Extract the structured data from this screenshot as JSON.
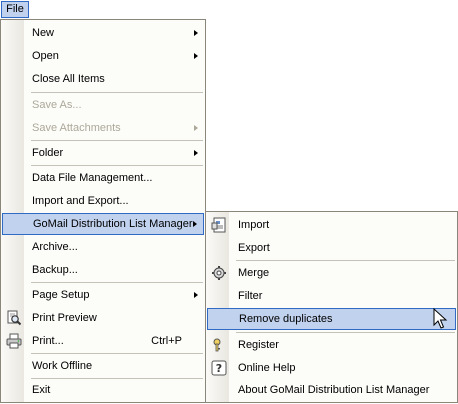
{
  "menubar": {
    "file": "File"
  },
  "file_menu": {
    "new": "New",
    "open": "Open",
    "close_all": "Close All Items",
    "save_as": "Save As...",
    "save_attachments": "Save Attachments",
    "folder": "Folder",
    "data_file_mgmt": "Data File Management...",
    "import_export": "Import and Export...",
    "gomail": "GoMail Distribution List Manager",
    "archive": "Archive...",
    "backup": "Backup...",
    "page_setup": "Page Setup",
    "print_preview": "Print Preview",
    "print": "Print...",
    "print_shortcut": "Ctrl+P",
    "work_offline": "Work Offline",
    "exit": "Exit"
  },
  "gomail_submenu": {
    "import": "Import",
    "export": "Export",
    "merge": "Merge",
    "filter": "Filter",
    "remove_duplicates": "Remove duplicates",
    "register": "Register",
    "online_help": "Online Help",
    "about": "About GoMail Distribution List Manager"
  },
  "colors": {
    "highlight_bg": "#c1d2ee",
    "highlight_border": "#316ac5",
    "menu_bg": "#fcfcf9",
    "disabled_text": "#aca899"
  },
  "icons": [
    "import-icon",
    "merge-icon",
    "register-icon",
    "help-icon",
    "print-preview-icon",
    "printer-icon",
    "mouse-cursor-icon"
  ]
}
